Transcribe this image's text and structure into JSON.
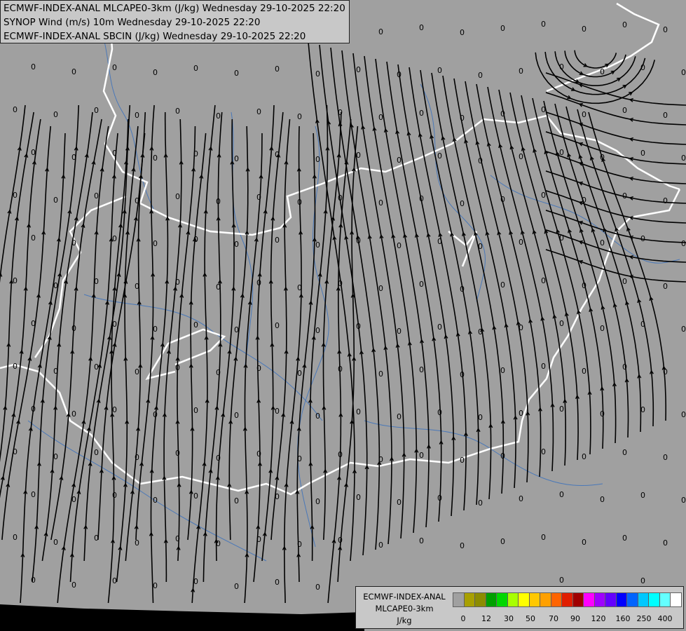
{
  "map": {
    "background": "#a0a0a0",
    "no_data_color": "#000000",
    "zero_marker": "0",
    "border_color": "#ffffff",
    "river_color": "#4a78b8",
    "line_color": "#000000"
  },
  "header": {
    "lines": [
      "ECMWF-INDEX-ANAL MLCAPE0-3km (J/kg) Wednesday 29-10-2025 22:20",
      "SYNOP Wind (m/s) 10m Wednesday 29-10-2025 22:20",
      "ECMWF-INDEX-ANAL SBCIN (J/kg) Wednesday 29-10-2025 22:20"
    ]
  },
  "legend": {
    "name_lines": [
      "ECMWF-INDEX-ANAL",
      "MLCAPE0-3km",
      "J/kg"
    ],
    "colors": [
      "#a0a0a0",
      "#a8a000",
      "#8c8c00",
      "#00a000",
      "#00d800",
      "#a8ff00",
      "#ffff00",
      "#ffc800",
      "#ffa000",
      "#ff6400",
      "#e01e00",
      "#a00000",
      "#ff00ff",
      "#a000ff",
      "#6400ff",
      "#0000ff",
      "#0064ff",
      "#00c8ff",
      "#00ffff",
      "#64ffff",
      "#ffffff"
    ],
    "tick_labels": [
      "0",
      "12",
      "30",
      "50",
      "70",
      "90",
      "120",
      "160",
      "250",
      "400"
    ]
  }
}
